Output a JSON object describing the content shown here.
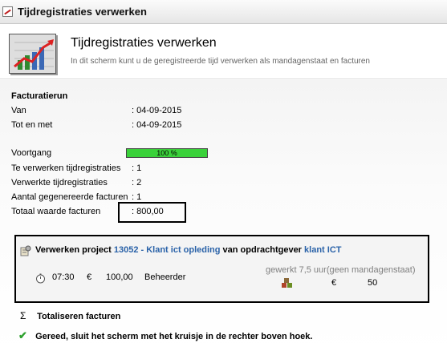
{
  "window": {
    "title": "Tijdregistraties verwerken",
    "icon": "chart-icon"
  },
  "header": {
    "heading": "Tijdregistraties verwerken",
    "subtitle": "In dit scherm kunt u de geregistreerde tijd verwerken als mandagenstaat en facturen",
    "logo_icon": "rising-chart-icon"
  },
  "run": {
    "section_title": "Facturatierun",
    "rows": [
      {
        "label": "Van",
        "value": ": 04-09-2015"
      },
      {
        "label": "Tot en met",
        "value": ": 04-09-2015"
      },
      {
        "label": "Voortgang",
        "value": ":"
      },
      {
        "label": "Te verwerken tijdregistraties",
        "value": ": 1"
      },
      {
        "label": "Verwerkte tijdregistraties",
        "value": ": 2"
      },
      {
        "label": "Aantal gegenereerde facturen",
        "value": ": 1"
      },
      {
        "label": "Totaal waarde facturen",
        "value": ": 800,00"
      }
    ],
    "progress": {
      "percent": 100,
      "label": "100 %",
      "color": "#3ad13a"
    }
  },
  "project": {
    "prefix": "Verwerken project",
    "project_link": "13052 - Klant ict opleding",
    "middle": "van opdrachtgever",
    "client_link": "klant ICT",
    "time": "07:30",
    "currency": "€",
    "amount": "100,00",
    "role": "Beheerder",
    "worked": "gewerkt 7,5 uur(geen mandagenstaat)",
    "currency2": "€",
    "amount2": "50",
    "link_color": "#2a62a8"
  },
  "steps": {
    "sum_symbol": "Σ",
    "sum_label": "Totaliseren facturen",
    "done_symbol": "✔",
    "done_label": "Gereed, sluit het scherm met het kruisje in de rechter boven hoek."
  }
}
